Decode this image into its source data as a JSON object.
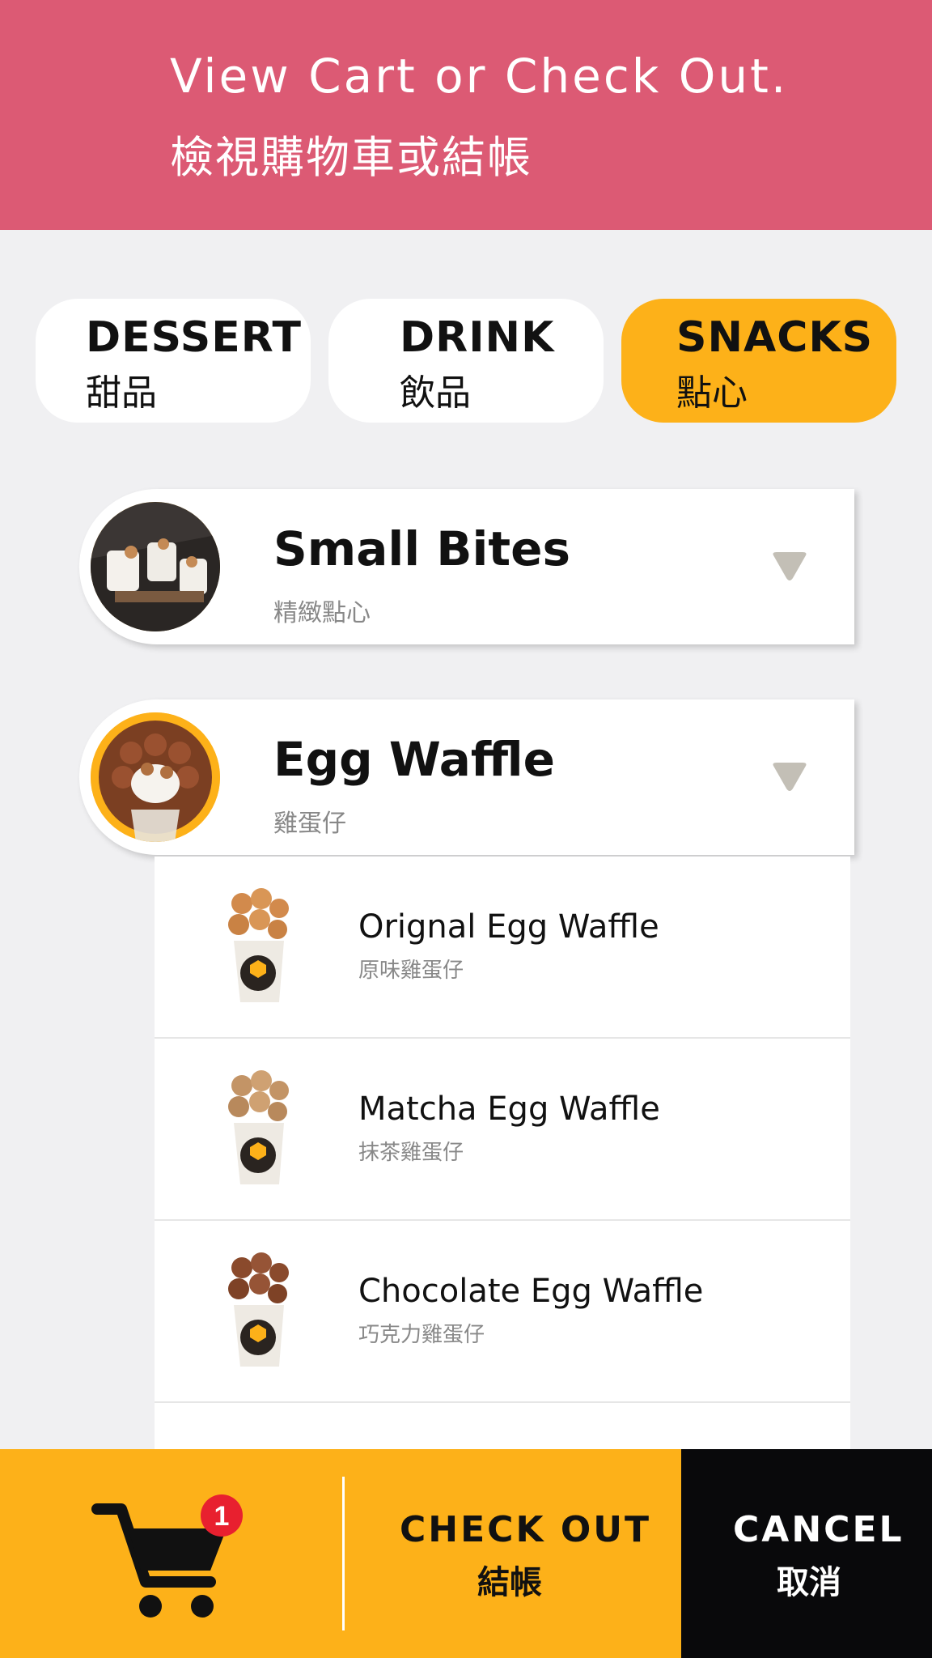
{
  "header": {
    "title_en": "View Cart or Check Out.",
    "title_zh": "檢視購物車或結帳"
  },
  "tabs": [
    {
      "label_en": "DESSERT",
      "label_zh": "甜品",
      "active": false
    },
    {
      "label_en": "DRINK",
      "label_zh": "飲品",
      "active": false
    },
    {
      "label_en": "SNACKS",
      "label_zh": "點心",
      "active": true
    }
  ],
  "categories": [
    {
      "name_en": "Small Bites",
      "name_zh": "精緻點心",
      "icon": "chevron-down-icon"
    },
    {
      "name_en": "Egg Waffle",
      "name_zh": "雞蛋仔",
      "icon": "chevron-down-icon"
    }
  ],
  "items": [
    {
      "name_en": "Orignal Egg Waffle",
      "name_zh": "原味雞蛋仔"
    },
    {
      "name_en": "Matcha Egg Waffle",
      "name_zh": "抹茶雞蛋仔"
    },
    {
      "name_en": "Chocolate Egg Waffle",
      "name_zh": "巧克力雞蛋仔"
    }
  ],
  "footer": {
    "cart_count": "1",
    "checkout_en": "CHECK OUT",
    "checkout_zh": "結帳",
    "cancel_en": "CANCEL",
    "cancel_zh": "取消"
  },
  "colors": {
    "header": "#dc5a74",
    "accent": "#fdb119",
    "cancel": "#09090b",
    "badge": "#e8202f"
  }
}
